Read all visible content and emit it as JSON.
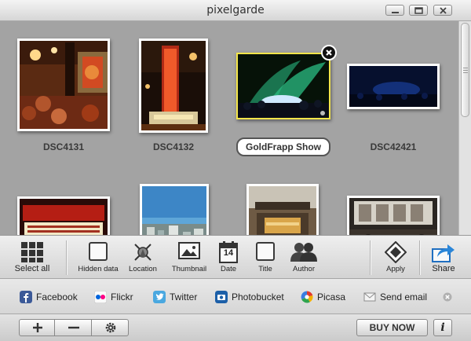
{
  "window": {
    "title": "pixelgarde"
  },
  "gallery": {
    "photos": [
      {
        "caption": "DSC4131",
        "selected": false
      },
      {
        "caption": "DSC4132",
        "selected": false
      },
      {
        "caption": "GoldFrapp Show",
        "selected": true
      },
      {
        "caption": "DSC42421",
        "selected": false
      },
      {
        "caption": "",
        "selected": false
      },
      {
        "caption": "",
        "selected": false
      },
      {
        "caption": "",
        "selected": false
      },
      {
        "caption": "",
        "selected": false
      }
    ],
    "selected_color": "#f5e64a"
  },
  "toolbar": {
    "select_all": "Select all",
    "hidden_data": "Hidden data",
    "location": "Location",
    "thumbnail": "Thumbnail",
    "date": "Date",
    "date_icon_number": "14",
    "title": "Title",
    "author": "Author",
    "apply": "Apply",
    "share": "Share"
  },
  "sharebar": {
    "items": [
      {
        "label": "Facebook",
        "icon": "facebook-icon",
        "color": "#3b5998"
      },
      {
        "label": "Flickr",
        "icon": "flickr-icon",
        "color": "#ff0084"
      },
      {
        "label": "Twitter",
        "icon": "twitter-icon",
        "color": "#4aa8e0"
      },
      {
        "label": "Photobucket",
        "icon": "photobucket-icon",
        "color": "#1c5fa8"
      },
      {
        "label": "Picasa",
        "icon": "picasa-icon",
        "color": "#e4a424"
      },
      {
        "label": "Send email",
        "icon": "email-icon",
        "color": "#9a9a9a"
      }
    ]
  },
  "bottombar": {
    "buy_now": "BUY NOW",
    "info": "i"
  }
}
